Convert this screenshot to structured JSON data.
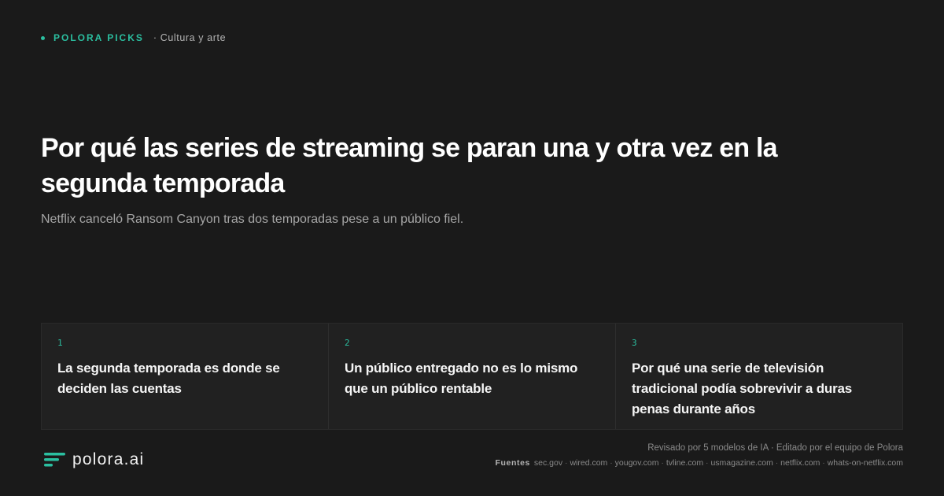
{
  "header": {
    "brand_tag": "POLORA PICKS",
    "section": "· Cultura y arte"
  },
  "article": {
    "title": "Por qué las series de streaming se paran una y otra vez en la segunda temporada",
    "subtitle": "Netflix canceló Ransom Canyon tras dos temporadas pese a un público fiel."
  },
  "cards": [
    {
      "num": "1",
      "text": "La segunda temporada es donde se deciden las cuentas"
    },
    {
      "num": "2",
      "text": "Un público entregado no es lo mismo que un público rentable"
    },
    {
      "num": "3",
      "text": "Por qué una serie de televisión tradicional podía sobrevivir a duras penas durante años"
    }
  ],
  "footer": {
    "logo_text": "polora.ai",
    "reviewed": "Revisado por 5 modelos de IA · Editado por el equipo de Polora",
    "sources_label": "Fuentes",
    "sources": [
      "sec.gov",
      "wired.com",
      "yougov.com",
      "tvline.com",
      "usmagazine.com",
      "netflix.com",
      "whats-on-netflix.com"
    ]
  },
  "colors": {
    "background": "#1a1a1a",
    "accent": "#2bbfa0",
    "card_bg": "#212121"
  },
  "icons": {
    "dot": "accent-dot-icon",
    "logo": "polora-logo-icon"
  }
}
